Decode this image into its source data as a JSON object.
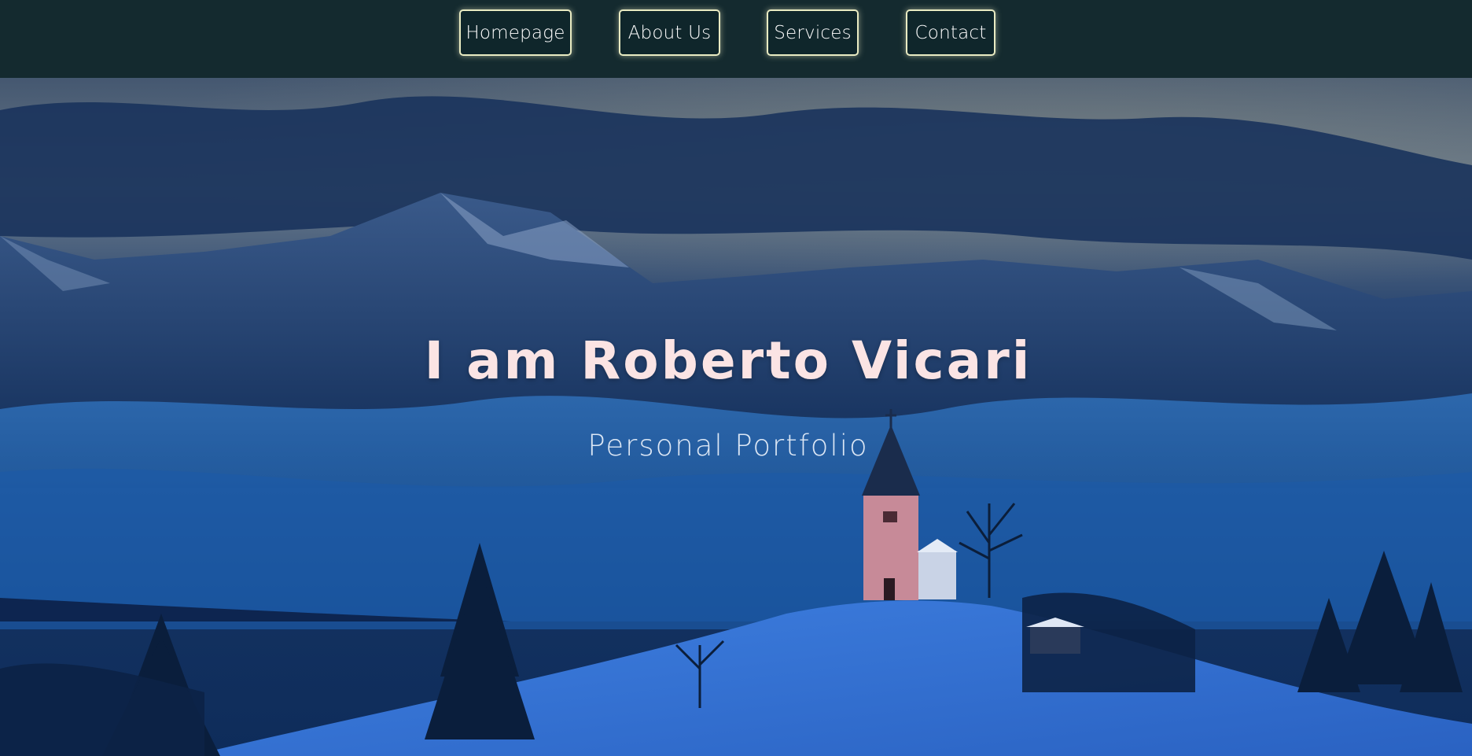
{
  "nav": {
    "items": [
      {
        "label": "Homepage"
      },
      {
        "label": "About Us"
      },
      {
        "label": "Services"
      },
      {
        "label": "Contact"
      }
    ]
  },
  "hero": {
    "title": "I am Roberto Vicari",
    "subtitle": "Personal Portfolio",
    "background": "winter-mountain-landscape-with-church"
  },
  "colors": {
    "navbar_bg": "#142a2f",
    "nav_border": "#e9ebc2",
    "title_color": "#fbe4e4",
    "subtitle_color": "#dce7f5",
    "sky_top": "#2a4a72",
    "snow": "#3b78d8"
  }
}
